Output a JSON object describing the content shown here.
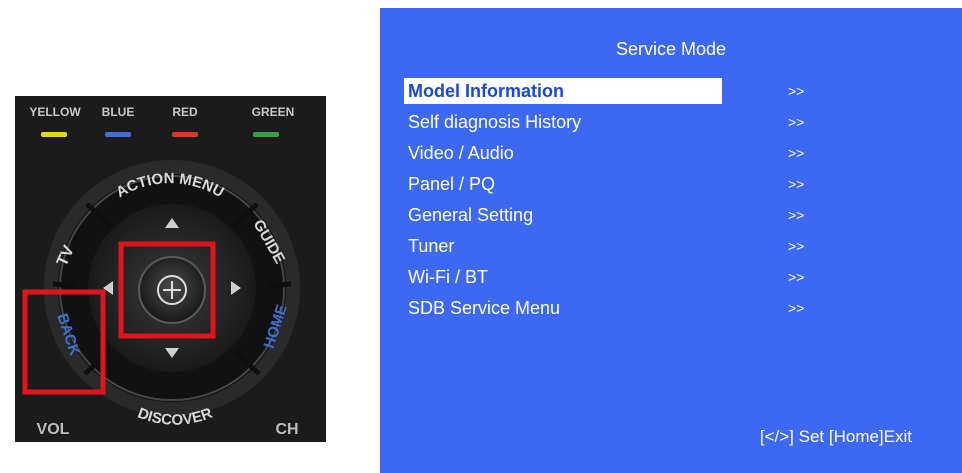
{
  "remote": {
    "color_keys": [
      {
        "label": "YELLOW",
        "color": "#e8d51c"
      },
      {
        "label": "BLUE",
        "color": "#3f6fd1"
      },
      {
        "label": "RED",
        "color": "#d23a2b"
      },
      {
        "label": "GREEN",
        "color": "#35a046"
      }
    ],
    "buttons": {
      "action_menu": "ACTION MENU",
      "guide": "GUIDE",
      "tv": "TV",
      "back": "BACK",
      "home": "HOME",
      "discover": "DISCOVER",
      "vol": "VOL",
      "ch": "CH"
    },
    "highlight_color": "#e0151c"
  },
  "service_menu": {
    "title": "Service Mode",
    "items": [
      {
        "label": "Model  Information",
        "arrow": ">>"
      },
      {
        "label": "Self diagnosis History",
        "arrow": ">>"
      },
      {
        "label": "Video / Audio",
        "arrow": ">>"
      },
      {
        "label": "Panel / PQ",
        "arrow": ">>"
      },
      {
        "label": "General Setting",
        "arrow": ">>"
      },
      {
        "label": "Tuner",
        "arrow": ">>"
      },
      {
        "label": "Wi-Fi / BT",
        "arrow": ">>"
      },
      {
        "label": "SDB Service Menu",
        "arrow": ">>"
      }
    ],
    "footer": "[</>] Set [Home]Exit",
    "background_color": "#3d68f2"
  }
}
